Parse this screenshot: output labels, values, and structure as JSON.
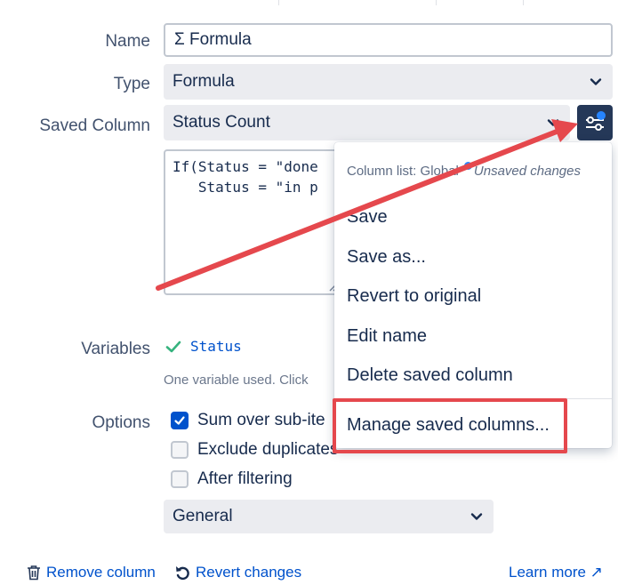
{
  "form": {
    "name_label": "Name",
    "name_value": "Σ Formula",
    "type_label": "Type",
    "type_value": "Formula",
    "saved_column_label": "Saved Column",
    "saved_column_value": "Status Count",
    "formula_line1": "If(Status = \"done",
    "formula_line2": "   Status = \"in p",
    "variables_label": "Variables",
    "variable_name": "Status",
    "variables_hint": "One variable used. Click",
    "options_label": "Options",
    "option_sum": "Sum over sub-ite",
    "option_sum_checked": true,
    "option_exclude": "Exclude duplicates",
    "option_exclude_checked": false,
    "option_after": "After filtering",
    "option_after_checked": false,
    "format_value": "General"
  },
  "footer": {
    "remove_column": "Remove column",
    "revert_changes": "Revert changes",
    "learn_more": "Learn more ↗"
  },
  "menu": {
    "header_prefix": "Column list: Global",
    "header_status": "Unsaved changes",
    "items": [
      "Save",
      "Save as...",
      "Revert to original",
      "Edit name",
      "Delete saved column",
      "Manage saved columns..."
    ]
  },
  "icons": {
    "saved_column_settings": "sliders-icon",
    "variable_status": "check-icon",
    "remove": "trash-icon",
    "revert": "undo-icon"
  },
  "colors": {
    "link": "#0052cc",
    "settings_button": "#253858",
    "annotation": "#e5484d",
    "unsaved_dot": "#2684ff",
    "check_green": "#36b37e"
  }
}
